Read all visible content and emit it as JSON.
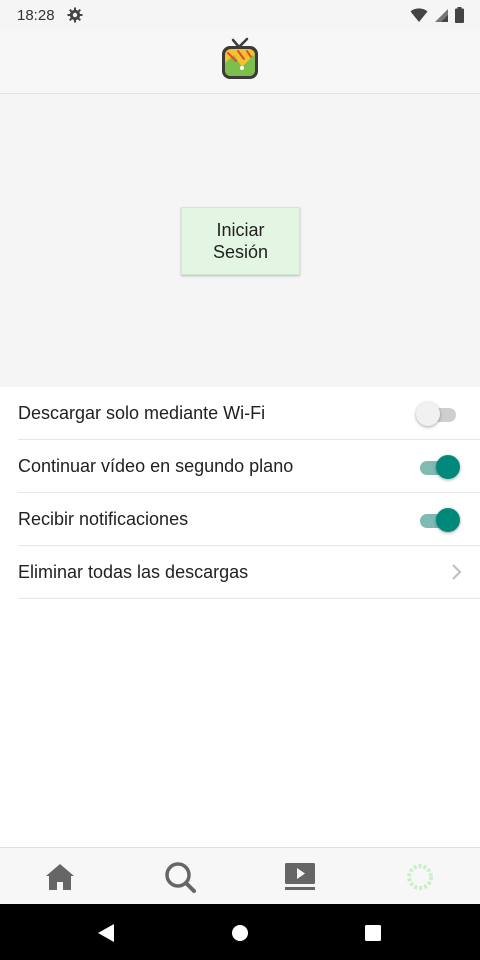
{
  "status_bar": {
    "time": "18:28",
    "icons": [
      "gear-icon",
      "wifi-icon",
      "signal-icon",
      "battery-icon"
    ]
  },
  "header": {
    "logo_icon": "tv-logo-icon"
  },
  "login": {
    "button_label": "Iniciar\nSesión"
  },
  "settings": {
    "items": [
      {
        "label": "Descargar solo mediante Wi-Fi",
        "control": "toggle",
        "enabled": false
      },
      {
        "label": "Continuar vídeo en segundo plano",
        "control": "toggle",
        "enabled": true
      },
      {
        "label": "Recibir notificaciones",
        "control": "toggle",
        "enabled": true
      },
      {
        "label": "Eliminar todas las descargas",
        "control": "chevron"
      }
    ]
  },
  "bottom_nav": {
    "items": [
      "home-icon",
      "search-icon",
      "video-library-icon",
      "settings-active-icon"
    ],
    "active_index": 3
  },
  "system_nav": {
    "items": [
      "back-icon",
      "home-circle-icon",
      "recents-icon"
    ]
  },
  "colors": {
    "accent": "#00897b",
    "accent_track": "#7fbab3",
    "login_button_bg": "#e3f6e3",
    "active_nav_icon": "#c8f0c8",
    "inactive_nav_icon": "#666666"
  }
}
